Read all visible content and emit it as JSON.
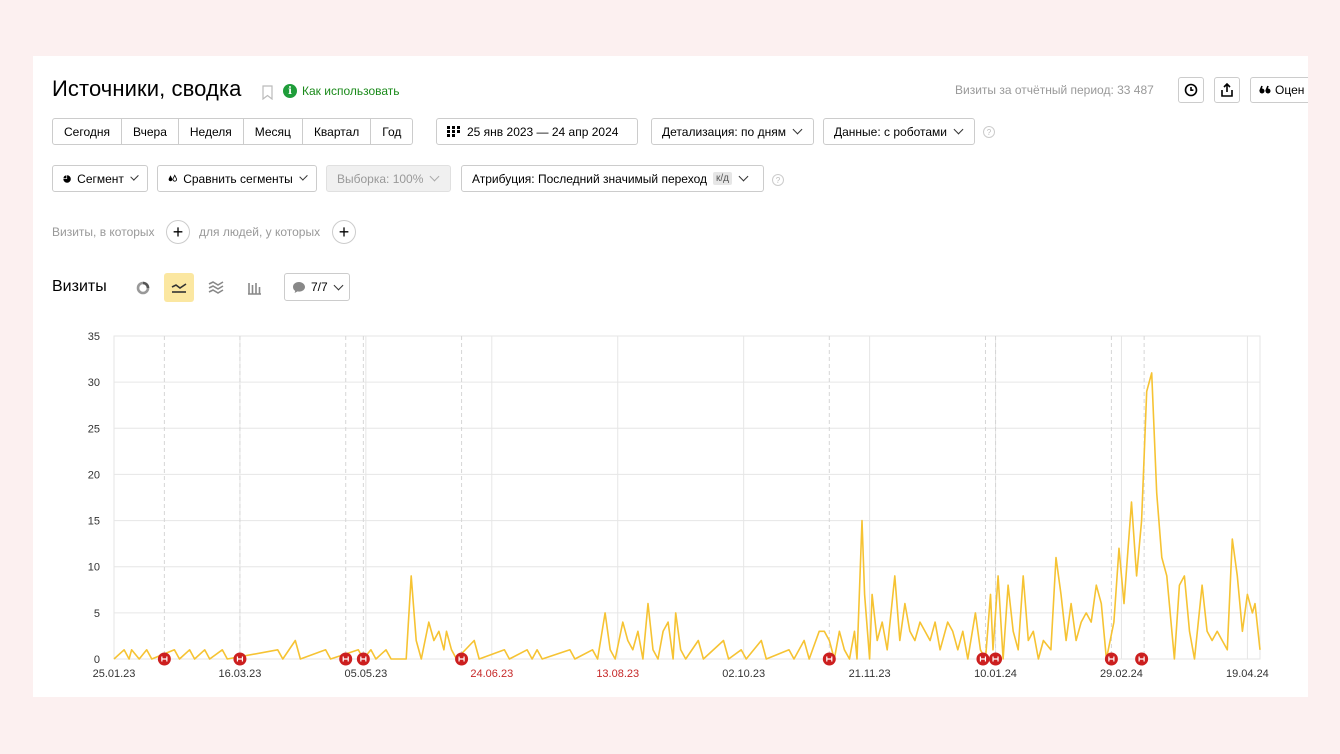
{
  "header": {
    "title": "Источники, сводка",
    "how_to_use": "Как использовать",
    "visits_total": "Визиты за отчётный период: 33 487",
    "rate_label": "Оцен"
  },
  "toolbar": {
    "periods": [
      "Сегодня",
      "Вчера",
      "Неделя",
      "Месяц",
      "Квартал",
      "Год"
    ],
    "date_range": "25 янв 2023 — 24 апр 2024",
    "detail": "Детализация: по дням",
    "data_mode": "Данные: с роботами",
    "segment": "Сегмент",
    "compare": "Сравнить сегменты",
    "sample": "Выборка: 100%",
    "attribution": "Атрибуция: Последний значимый переход",
    "attribution_badge": "к/д"
  },
  "filters": {
    "visits_label": "Визиты, в которых",
    "people_label": "для людей, у которых"
  },
  "chart_header": {
    "title": "Визиты",
    "notes_count": "7/7"
  },
  "colors": {
    "line": "#f6c333",
    "note_marker": "#cc1f1f",
    "red_label": "#c62828",
    "accent_green": "#1f9d3a"
  },
  "chart_data": {
    "type": "line",
    "series": [
      {
        "name": "",
        "color": "#f6c333"
      }
    ],
    "ylim": [
      0,
      35
    ],
    "yticks": [
      0,
      5,
      10,
      15,
      20,
      25,
      30,
      35
    ],
    "x_start": "2023-01-25",
    "x_end": "2024-04-24",
    "xticks": [
      {
        "label": "25.01.23",
        "date": "2023-01-25",
        "red": false
      },
      {
        "label": "16.03.23",
        "date": "2023-03-16",
        "red": false
      },
      {
        "label": "05.05.23",
        "date": "2023-05-05",
        "red": false
      },
      {
        "label": "24.06.23",
        "date": "2023-06-24",
        "red": true
      },
      {
        "label": "13.08.23",
        "date": "2023-08-13",
        "red": true
      },
      {
        "label": "02.10.23",
        "date": "2023-10-02",
        "red": false
      },
      {
        "label": "21.11.23",
        "date": "2023-11-21",
        "red": false
      },
      {
        "label": "10.01.24",
        "date": "2024-01-10",
        "red": false
      },
      {
        "label": "29.02.24",
        "date": "2024-02-29",
        "red": false
      },
      {
        "label": "19.04.24",
        "date": "2024-04-19",
        "red": false
      }
    ],
    "points": [
      [
        "2023-01-25",
        0
      ],
      [
        "2023-01-29",
        1
      ],
      [
        "2023-01-31",
        0
      ],
      [
        "2023-02-01",
        1
      ],
      [
        "2023-02-04",
        0
      ],
      [
        "2023-02-07",
        1
      ],
      [
        "2023-02-09",
        0
      ],
      [
        "2023-02-18",
        1
      ],
      [
        "2023-02-20",
        0
      ],
      [
        "2023-02-24",
        1
      ],
      [
        "2023-02-26",
        0
      ],
      [
        "2023-03-02",
        1
      ],
      [
        "2023-03-04",
        0
      ],
      [
        "2023-03-09",
        1
      ],
      [
        "2023-03-11",
        0
      ],
      [
        "2023-03-31",
        1
      ],
      [
        "2023-04-02",
        0
      ],
      [
        "2023-04-07",
        2
      ],
      [
        "2023-04-09",
        0
      ],
      [
        "2023-04-19",
        1
      ],
      [
        "2023-04-21",
        0
      ],
      [
        "2023-05-02",
        1
      ],
      [
        "2023-05-04",
        0
      ],
      [
        "2023-05-07",
        1
      ],
      [
        "2023-05-09",
        0
      ],
      [
        "2023-05-13",
        1
      ],
      [
        "2023-05-15",
        0
      ],
      [
        "2023-05-21",
        0
      ],
      [
        "2023-05-23",
        9
      ],
      [
        "2023-05-25",
        2
      ],
      [
        "2023-05-27",
        0
      ],
      [
        "2023-05-30",
        4
      ],
      [
        "2023-06-01",
        2
      ],
      [
        "2023-06-03",
        3
      ],
      [
        "2023-06-05",
        1
      ],
      [
        "2023-06-06",
        3
      ],
      [
        "2023-06-08",
        1
      ],
      [
        "2023-06-10",
        0
      ],
      [
        "2023-06-17",
        2
      ],
      [
        "2023-06-19",
        0
      ],
      [
        "2023-06-29",
        1
      ],
      [
        "2023-07-01",
        0
      ],
      [
        "2023-07-08",
        1
      ],
      [
        "2023-07-10",
        0
      ],
      [
        "2023-07-12",
        1
      ],
      [
        "2023-07-14",
        0
      ],
      [
        "2023-07-25",
        1
      ],
      [
        "2023-07-27",
        0
      ],
      [
        "2023-08-03",
        1
      ],
      [
        "2023-08-05",
        0
      ],
      [
        "2023-08-08",
        5
      ],
      [
        "2023-08-10",
        1
      ],
      [
        "2023-08-12",
        0
      ],
      [
        "2023-08-15",
        4
      ],
      [
        "2023-08-17",
        2
      ],
      [
        "2023-08-19",
        1
      ],
      [
        "2023-08-21",
        3
      ],
      [
        "2023-08-23",
        0
      ],
      [
        "2023-08-25",
        6
      ],
      [
        "2023-08-27",
        1
      ],
      [
        "2023-08-29",
        0
      ],
      [
        "2023-08-31",
        3
      ],
      [
        "2023-09-02",
        4
      ],
      [
        "2023-09-04",
        0
      ],
      [
        "2023-09-05",
        5
      ],
      [
        "2023-09-07",
        1
      ],
      [
        "2023-09-09",
        0
      ],
      [
        "2023-09-14",
        2
      ],
      [
        "2023-09-16",
        0
      ],
      [
        "2023-09-24",
        2
      ],
      [
        "2023-09-26",
        0
      ],
      [
        "2023-10-01",
        1
      ],
      [
        "2023-10-03",
        0
      ],
      [
        "2023-10-09",
        2
      ],
      [
        "2023-10-11",
        0
      ],
      [
        "2023-10-20",
        1
      ],
      [
        "2023-10-22",
        0
      ],
      [
        "2023-10-26",
        2
      ],
      [
        "2023-10-28",
        0
      ],
      [
        "2023-11-01",
        3
      ],
      [
        "2023-11-03",
        3
      ],
      [
        "2023-11-05",
        2
      ],
      [
        "2023-11-07",
        0
      ],
      [
        "2023-11-09",
        3
      ],
      [
        "2023-11-11",
        1
      ],
      [
        "2023-11-13",
        0
      ],
      [
        "2023-11-15",
        3
      ],
      [
        "2023-11-16",
        0
      ],
      [
        "2023-11-18",
        15
      ],
      [
        "2023-11-19",
        7
      ],
      [
        "2023-11-21",
        0
      ],
      [
        "2023-11-22",
        7
      ],
      [
        "2023-11-24",
        2
      ],
      [
        "2023-11-26",
        4
      ],
      [
        "2023-11-28",
        1
      ],
      [
        "2023-12-01",
        9
      ],
      [
        "2023-12-03",
        2
      ],
      [
        "2023-12-05",
        6
      ],
      [
        "2023-12-07",
        3
      ],
      [
        "2023-12-09",
        2
      ],
      [
        "2023-12-11",
        4
      ],
      [
        "2023-12-13",
        3
      ],
      [
        "2023-12-15",
        2
      ],
      [
        "2023-12-17",
        4
      ],
      [
        "2023-12-19",
        1
      ],
      [
        "2023-12-22",
        4
      ],
      [
        "2023-12-24",
        3
      ],
      [
        "2023-12-26",
        1
      ],
      [
        "2023-12-28",
        3
      ],
      [
        "2023-12-30",
        0
      ],
      [
        "2024-01-02",
        5
      ],
      [
        "2024-01-04",
        1
      ],
      [
        "2024-01-06",
        0
      ],
      [
        "2024-01-08",
        7
      ],
      [
        "2024-01-09",
        1
      ],
      [
        "2024-01-11",
        9
      ],
      [
        "2024-01-13",
        0
      ],
      [
        "2024-01-15",
        8
      ],
      [
        "2024-01-17",
        3
      ],
      [
        "2024-01-19",
        1
      ],
      [
        "2024-01-21",
        9
      ],
      [
        "2024-01-23",
        2
      ],
      [
        "2024-01-25",
        3
      ],
      [
        "2024-01-27",
        0
      ],
      [
        "2024-01-29",
        2
      ],
      [
        "2024-02-01",
        1
      ],
      [
        "2024-02-03",
        11
      ],
      [
        "2024-02-05",
        7
      ],
      [
        "2024-02-07",
        2
      ],
      [
        "2024-02-09",
        6
      ],
      [
        "2024-02-11",
        2
      ],
      [
        "2024-02-13",
        4
      ],
      [
        "2024-02-15",
        5
      ],
      [
        "2024-02-17",
        4
      ],
      [
        "2024-02-19",
        8
      ],
      [
        "2024-02-21",
        6
      ],
      [
        "2024-02-23",
        0
      ],
      [
        "2024-02-26",
        4
      ],
      [
        "2024-02-28",
        12
      ],
      [
        "2024-03-01",
        6
      ],
      [
        "2024-03-04",
        17
      ],
      [
        "2024-03-06",
        9
      ],
      [
        "2024-03-08",
        15
      ],
      [
        "2024-03-10",
        29
      ],
      [
        "2024-03-12",
        31
      ],
      [
        "2024-03-14",
        18
      ],
      [
        "2024-03-16",
        11
      ],
      [
        "2024-03-18",
        9
      ],
      [
        "2024-03-21",
        0
      ],
      [
        "2024-03-23",
        8
      ],
      [
        "2024-03-25",
        9
      ],
      [
        "2024-03-27",
        3
      ],
      [
        "2024-03-29",
        0
      ],
      [
        "2024-04-01",
        8
      ],
      [
        "2024-04-03",
        3
      ],
      [
        "2024-04-05",
        2
      ],
      [
        "2024-04-07",
        3
      ],
      [
        "2024-04-09",
        2
      ],
      [
        "2024-04-11",
        1
      ],
      [
        "2024-04-13",
        13
      ],
      [
        "2024-04-15",
        9
      ],
      [
        "2024-04-17",
        3
      ],
      [
        "2024-04-19",
        7
      ],
      [
        "2024-04-21",
        5
      ],
      [
        "2024-04-22",
        6
      ],
      [
        "2024-04-24",
        1
      ]
    ],
    "notes": [
      {
        "date": "2023-02-14"
      },
      {
        "date": "2023-03-16"
      },
      {
        "date": "2023-04-27"
      },
      {
        "date": "2023-05-04"
      },
      {
        "date": "2023-06-12"
      },
      {
        "date": "2023-11-05"
      },
      {
        "date": "2024-01-05"
      },
      {
        "date": "2024-01-10"
      },
      {
        "date": "2024-02-25"
      },
      {
        "date": "2024-03-08"
      }
    ],
    "dashed_markers": [
      "2023-02-14",
      "2023-03-16",
      "2023-04-27",
      "2023-05-04",
      "2023-06-12",
      "2023-11-05",
      "2024-01-06",
      "2024-01-10",
      "2024-02-25",
      "2024-03-09"
    ]
  }
}
